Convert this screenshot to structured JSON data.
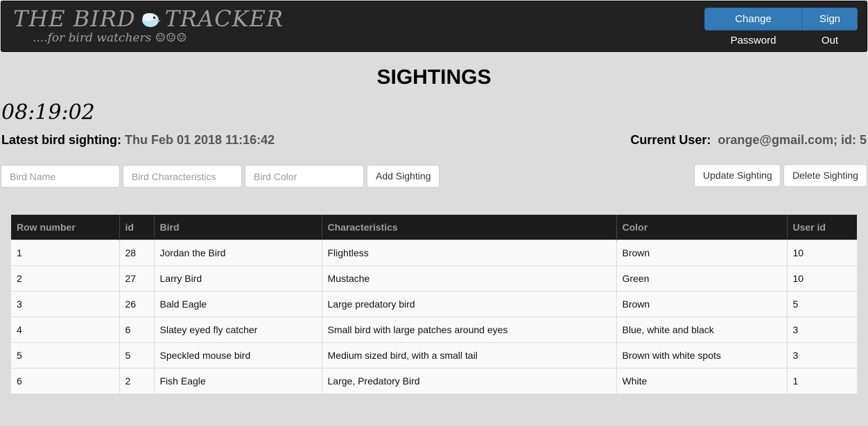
{
  "navbar": {
    "brand_title_left": "THE BIRD",
    "brand_title_right": "TRACKER",
    "brand_subtitle": "....for bird watchers ☺☺☺",
    "brand_icon": "bird-icon",
    "change_password_label": "Change Password",
    "sign_out_label": "Sign Out",
    "accent_color": "#337ab7"
  },
  "page": {
    "title": "SIGHTINGS",
    "clock": "08:19:02",
    "latest_label": "Latest bird sighting:",
    "latest_value": "Thu Feb 01 2018 11:16:42",
    "current_user_label": "Current User:",
    "current_user_value": "orange@gmail.com; id: 5"
  },
  "form": {
    "bird_name_placeholder": "Bird Name",
    "characteristics_placeholder": "Bird Characteristics",
    "color_placeholder": "Bird Color",
    "add_label": "Add Sighting",
    "update_label": "Update Sighting",
    "delete_label": "Delete Sighting"
  },
  "table": {
    "headers": [
      "Row number",
      "id",
      "Bird",
      "Characteristics",
      "Color",
      "User id"
    ],
    "rows": [
      [
        "1",
        "28",
        "Jordan the Bird",
        "Flightless",
        "Brown",
        "10"
      ],
      [
        "2",
        "27",
        "Larry Bird",
        "Mustache",
        "Green",
        "10"
      ],
      [
        "3",
        "26",
        "Bald Eagle",
        "Large predatory bird",
        "Brown",
        "5"
      ],
      [
        "4",
        "6",
        "Slatey eyed fly catcher",
        "Small bird with large patches around eyes",
        "Blue, white and black",
        "3"
      ],
      [
        "5",
        "5",
        "Speckled mouse bird",
        "Medium sized bird, with a small tail",
        "Brown with white spots",
        "3"
      ],
      [
        "6",
        "2",
        "Fish Eagle",
        "Large, Predatory Bird",
        "White",
        "1"
      ]
    ]
  }
}
